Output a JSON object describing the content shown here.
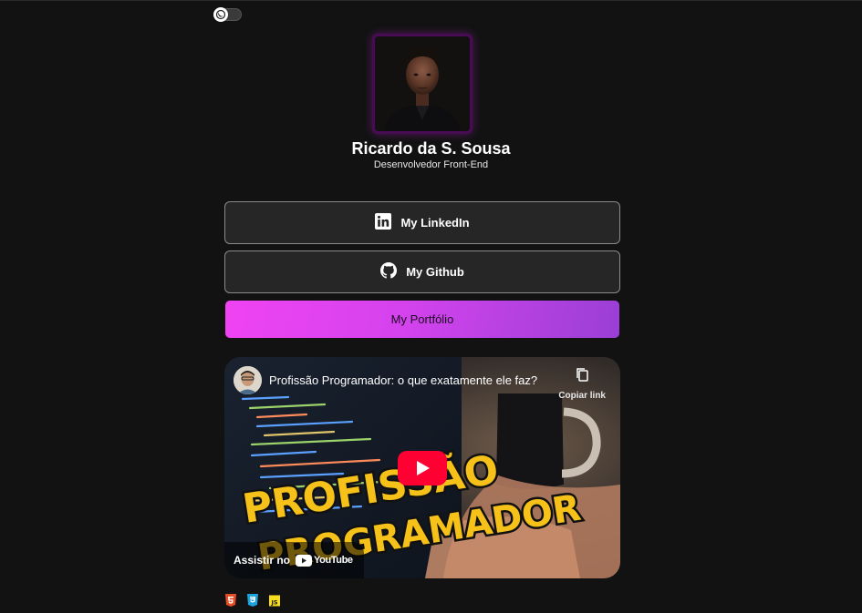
{
  "theme_toggle": {
    "icon": "moon-icon",
    "state": "dark"
  },
  "profile": {
    "name": "Ricardo da S. Sousa",
    "role": "Desenvolvedor Front-End",
    "avatar_icon": "profile-photo"
  },
  "links": [
    {
      "label": "My LinkedIn",
      "icon": "linkedin-icon"
    },
    {
      "label": "My Github",
      "icon": "github-icon"
    },
    {
      "label": "My Portfólio",
      "icon": ""
    }
  ],
  "video": {
    "title": "Profissão Programador: o que exatamente ele faz?",
    "copy_link_label": "Copiar link",
    "thumbnail_text_line1": "PROFISSÃO",
    "thumbnail_text_line2": "PROGRAMADOR",
    "watch_on_label": "Assistir no",
    "brand_label": "YouTube"
  },
  "tech_icons": [
    {
      "icon": "html5-icon",
      "color": "#e44d26"
    },
    {
      "icon": "css3-icon",
      "color": "#1ca3dc"
    },
    {
      "icon": "js-icon",
      "label": "JS",
      "color": "#f7df1e"
    }
  ],
  "colors": {
    "background": "#121212",
    "button_bg": "#262626",
    "portfolio_gradient_start": "#f043f2",
    "portfolio_gradient_end": "#9a3fd6",
    "avatar_border": "#4a0b55",
    "youtube_red": "#ff0000"
  }
}
